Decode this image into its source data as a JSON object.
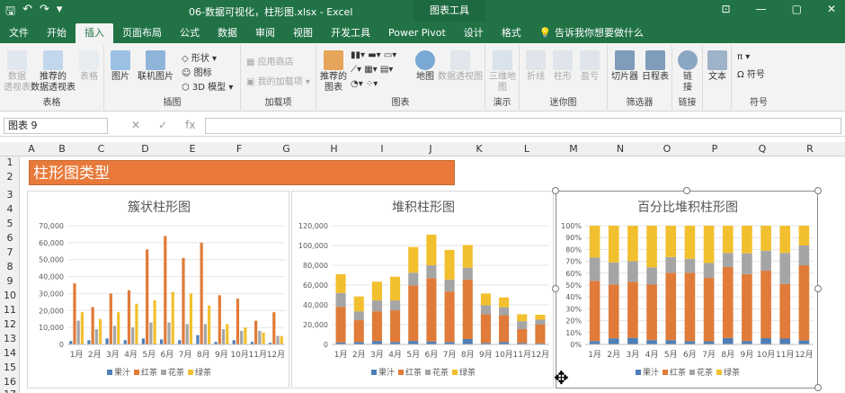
{
  "window": {
    "title": "06-数据可视化，柱形图.xlsx  -  Excel",
    "context_tab": "图表工具",
    "min": "—",
    "restore": "▢",
    "close": "✕",
    "ribbon_opts": "⊡"
  },
  "tabs": [
    "文件",
    "开始",
    "插入",
    "页面布局",
    "公式",
    "数据",
    "审阅",
    "视图",
    "开发工具",
    "Power Pivot",
    "设计",
    "格式"
  ],
  "tell_me": "告诉我你想要做什么",
  "ribbon": {
    "tables": {
      "name": "表格",
      "pivot": "数据\n透视表",
      "rec_pivot": "推荐的\n数据透视表",
      "table": "表格"
    },
    "illus": {
      "name": "插图",
      "pictures": "图片",
      "online_pictures": "联机图片",
      "shapes": "形状",
      "icons": "图标",
      "model3d": "3D 模型"
    },
    "addins": {
      "name": "加载项",
      "store": "应用商店",
      "my_addins": "我的加载项"
    },
    "charts": {
      "name": "图表",
      "recommended": "推荐的\n图表",
      "map": "地图",
      "pivot_chart": "数据透视图"
    },
    "tours": {
      "name": "演示",
      "map3d": "三维地\n图"
    },
    "sparklines": {
      "name": "迷你图",
      "line": "折线",
      "column": "柱形",
      "winloss": "盈亏"
    },
    "filters": {
      "name": "筛选器",
      "slicer": "切片器",
      "timeline": "日程表"
    },
    "links": {
      "name": "链接",
      "link": "链\n接"
    },
    "text": {
      "name": "",
      "text": "文本"
    },
    "symbols": {
      "name": "符号",
      "symbol": "符号",
      "eq": "Ω"
    }
  },
  "namebox": "图表 9",
  "columns": [
    "A",
    "B",
    "C",
    "D",
    "E",
    "F",
    "G",
    "H",
    "I",
    "J",
    "K",
    "L",
    "M",
    "N",
    "O",
    "P",
    "Q",
    "R"
  ],
  "rows": [
    "1",
    "2",
    "3",
    "4",
    "5",
    "6",
    "7",
    "8",
    "9",
    "10",
    "11",
    "12",
    "13",
    "14",
    "15",
    "16",
    "17"
  ],
  "banner": "柱形图类型",
  "colors": {
    "果汁": "#4e7fb7",
    "红茶": "#e07b39",
    "花茶": "#a5a5a5",
    "绿茶": "#f2c02f"
  },
  "chart_data": [
    {
      "type": "bar",
      "title": "簇状柱形图",
      "categories": [
        "1月",
        "2月",
        "3月",
        "4月",
        "5月",
        "6月",
        "7月",
        "8月",
        "9月",
        "10月",
        "11月",
        "12月"
      ],
      "ylim": [
        0,
        70000
      ],
      "yticks": [
        "0",
        "10,000",
        "20,000",
        "30,000",
        "40,000",
        "50,000",
        "60,000",
        "70,000"
      ],
      "legend": "bottom",
      "series": [
        {
          "name": "果汁",
          "values": [
            2000,
            2500,
            3500,
            2500,
            3500,
            3000,
            2500,
            5500,
            1500,
            2500,
            1500,
            1000
          ]
        },
        {
          "name": "红茶",
          "values": [
            36000,
            22000,
            30000,
            32000,
            56000,
            64000,
            51000,
            60000,
            29000,
            27000,
            14000,
            19000
          ]
        },
        {
          "name": "花茶",
          "values": [
            14000,
            9000,
            11000,
            10000,
            13000,
            13000,
            12000,
            12000,
            9000,
            8000,
            8000,
            5000
          ]
        },
        {
          "name": "绿茶",
          "values": [
            19000,
            15000,
            19000,
            24000,
            26000,
            31000,
            30000,
            23000,
            12000,
            10000,
            7000,
            5000
          ]
        }
      ]
    },
    {
      "type": "bar",
      "title": "堆积柱形图",
      "categories": [
        "1月",
        "2月",
        "3月",
        "4月",
        "5月",
        "6月",
        "7月",
        "8月",
        "9月",
        "10月",
        "11月",
        "12月"
      ],
      "ylim": [
        0,
        120000
      ],
      "yticks": [
        "0",
        "20,000",
        "40,000",
        "60,000",
        "80,000",
        "100,000",
        "120,000"
      ],
      "legend": "bottom",
      "series": [
        {
          "name": "果汁",
          "values": [
            2000,
            2500,
            3500,
            2500,
            3500,
            3000,
            2500,
            5500,
            1500,
            2500,
            1500,
            1000
          ]
        },
        {
          "name": "红茶",
          "values": [
            36000,
            22000,
            30000,
            32000,
            56000,
            64000,
            51000,
            60000,
            29000,
            27000,
            14000,
            19000
          ]
        },
        {
          "name": "花茶",
          "values": [
            14000,
            9000,
            11000,
            10000,
            13000,
            13000,
            12000,
            12000,
            9000,
            8000,
            8000,
            5000
          ]
        },
        {
          "name": "绿茶",
          "values": [
            19000,
            15000,
            19000,
            24000,
            26000,
            31000,
            30000,
            23000,
            12000,
            10000,
            7000,
            5000
          ]
        }
      ]
    },
    {
      "type": "bar",
      "title": "百分比堆积柱形图",
      "categories": [
        "1月",
        "2月",
        "3月",
        "4月",
        "5月",
        "6月",
        "7月",
        "8月",
        "9月",
        "10月",
        "11月",
        "12月"
      ],
      "ylim": [
        0,
        100
      ],
      "yticks": [
        "0%",
        "10%",
        "20%",
        "30%",
        "40%",
        "50%",
        "60%",
        "70%",
        "80%",
        "90%",
        "100%"
      ],
      "legend": "bottom",
      "series": [
        {
          "name": "果汁",
          "values": [
            2000,
            2500,
            3500,
            2500,
            3500,
            3000,
            2500,
            5500,
            1500,
            2500,
            1500,
            1000
          ]
        },
        {
          "name": "红茶",
          "values": [
            36000,
            22000,
            30000,
            32000,
            56000,
            64000,
            51000,
            60000,
            29000,
            27000,
            14000,
            19000
          ]
        },
        {
          "name": "花茶",
          "values": [
            14000,
            9000,
            11000,
            10000,
            13000,
            13000,
            12000,
            12000,
            9000,
            8000,
            8000,
            5000
          ]
        },
        {
          "name": "绿茶",
          "values": [
            19000,
            15000,
            19000,
            24000,
            26000,
            31000,
            30000,
            23000,
            12000,
            10000,
            7000,
            5000
          ]
        }
      ]
    }
  ]
}
